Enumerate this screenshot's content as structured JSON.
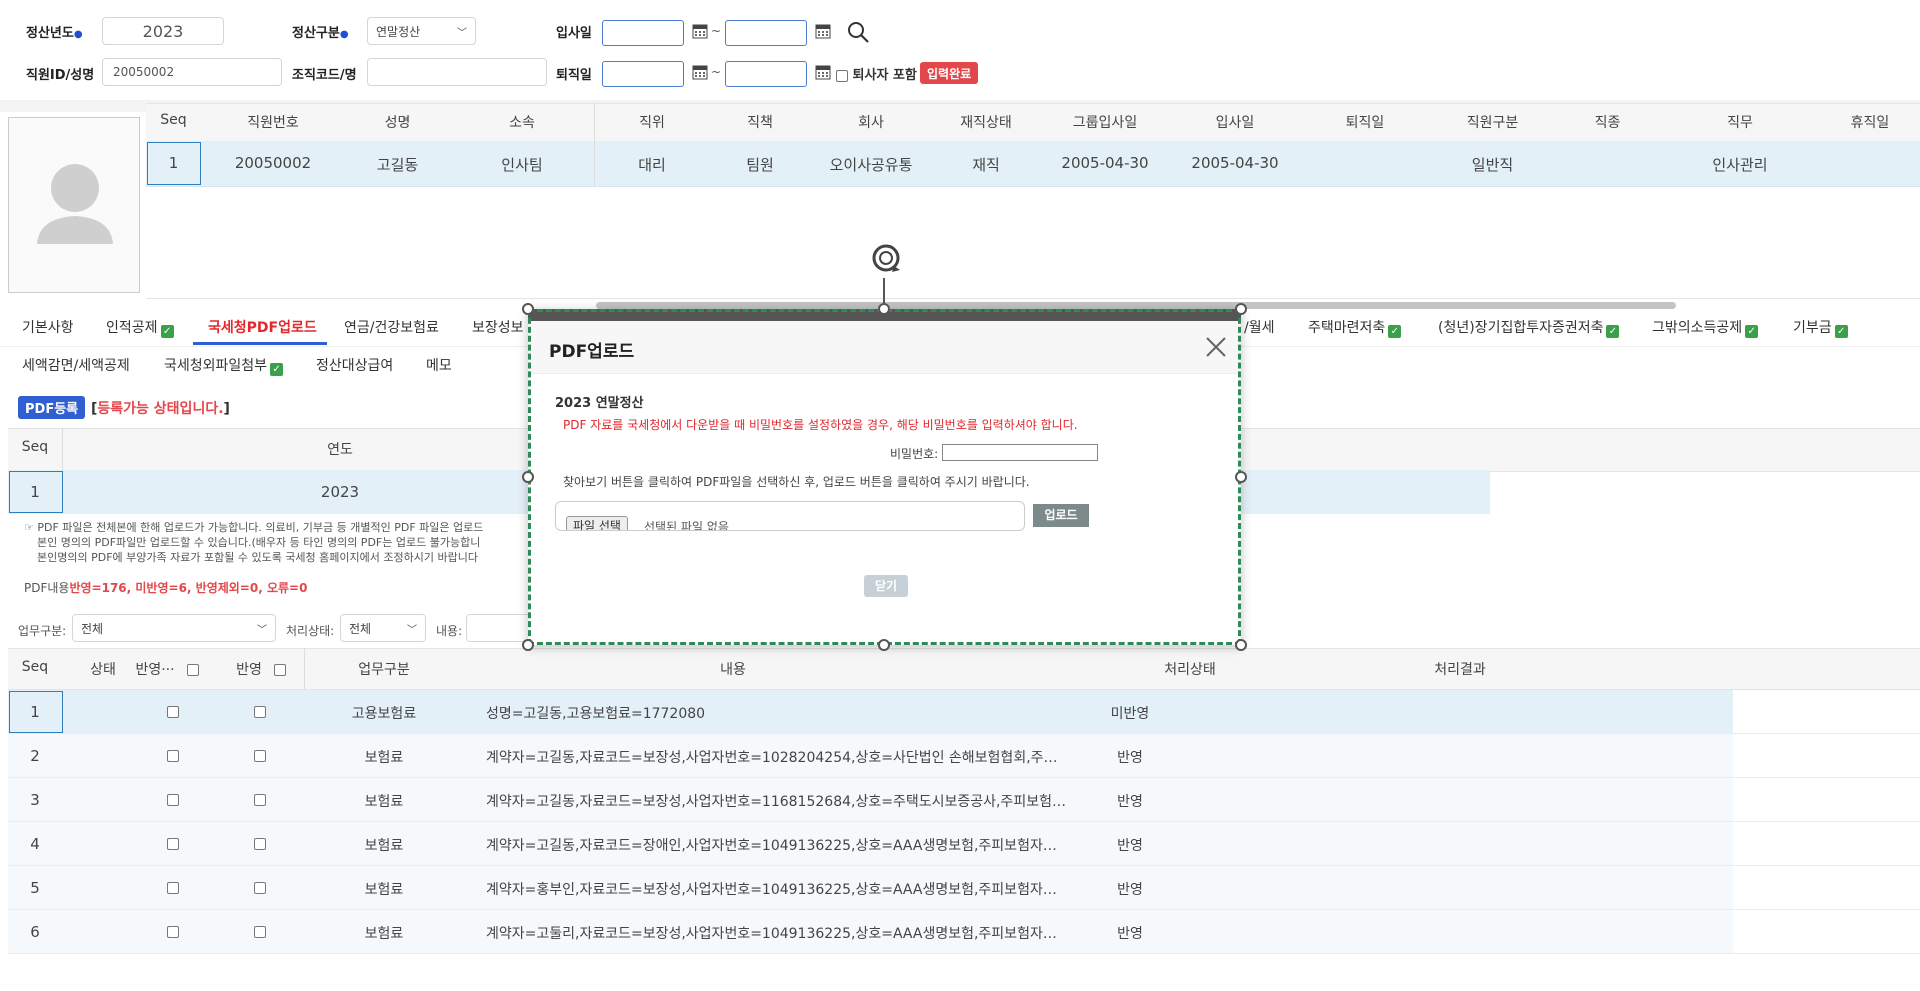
{
  "filters": {
    "year_label": "정산년도",
    "year_value": "2023",
    "type_label": "정산구분",
    "type_value": "연말정산",
    "hire_label": "입사일",
    "tilde": "~",
    "emp_label": "직원ID/성명",
    "emp_value": "20050002",
    "org_label": "조직코드/명",
    "retire_label": "퇴직일",
    "include_retired_label": "퇴사자 포함",
    "input_done_badge": "입력완료"
  },
  "employee_grid": {
    "headers": [
      "Seq",
      "직원번호",
      "성명",
      "소속",
      "직위",
      "직책",
      "회사",
      "재직상태",
      "그룹입사일",
      "입사일",
      "퇴직일",
      "직원구분",
      "직종",
      "직무",
      "휴직일"
    ],
    "row": [
      "1",
      "20050002",
      "고길동",
      "인사팀",
      "대리",
      "팀원",
      "오이사공유통",
      "재직",
      "2005-04-30",
      "2005-04-30",
      "",
      "일반직",
      "",
      "인사관리",
      ""
    ]
  },
  "tabs_row1": [
    {
      "label": "기본사항",
      "check": false
    },
    {
      "label": "인적공제",
      "check": true
    },
    {
      "label": "국세청PDF업로드",
      "check": false,
      "active": true
    },
    {
      "label": "연금/건강보험료",
      "check": false
    },
    {
      "label": "보장성보",
      "check": false
    },
    {
      "label": "/월세",
      "check": false
    },
    {
      "label": "주택마련저축",
      "check": true
    },
    {
      "label": "(청년)장기집합투자증권저축",
      "check": true
    },
    {
      "label": "그밖의소득공제",
      "check": true
    },
    {
      "label": "기부금",
      "check": true
    }
  ],
  "tabs_row2": [
    {
      "label": "세액감면/세액공제",
      "check": false
    },
    {
      "label": "국세청외파일첨부",
      "check": true
    },
    {
      "label": "정산대상급여",
      "check": false
    },
    {
      "label": "메모",
      "check": false
    }
  ],
  "pdf_section": {
    "register_button": "PDF등록",
    "status_open": "[",
    "status_text": "등록가능 상태입니다.",
    "status_close": "]",
    "grid_headers": [
      "Seq",
      "연도"
    ],
    "grid_row": [
      "1",
      "2023"
    ],
    "note_line1": "☞ PDF 파일은 전체본에 한해 업로드가 가능합니다. 의료비, 기부금 등 개별적인 PDF 파일은 업로드",
    "note_line2": "본인 명의의 PDF파일만 업로드할 수 있습니다.(배우자 등 타인 명의의 PDF는 업로드 불가능합니",
    "note_line3": "본인명의의 PDF에 부양가족 자료가 포함될 수 있도록 국세청 홈페이지에서 조정하시기 바랍니다",
    "content_label": "PDF내용",
    "content_summary": "반영=176, 미반영=6, 반영제외=0, 오류=0"
  },
  "detail_filters": {
    "biz_label": "업무구분:",
    "biz_value": "전체",
    "status_label": "처리상태:",
    "status_value": "전체",
    "content_label": "내용:"
  },
  "detail_grid": {
    "headers": [
      "Seq",
      "상태",
      "반영···",
      "반영",
      "업무구분",
      "내용",
      "처리상태",
      "처리결과"
    ],
    "rows": [
      {
        "seq": "1",
        "biz": "고용보험료",
        "content": "성명=고길동,고용보험료=1772080",
        "status": "미반영"
      },
      {
        "seq": "2",
        "biz": "보험료",
        "content": "계약자=고길동,자료코드=보장성,사업자번호=1028204254,상호=사단법인 손해보험협회,주피보…",
        "status": "반영"
      },
      {
        "seq": "3",
        "biz": "보험료",
        "content": "계약자=고길동,자료코드=보장성,사업자번호=1168152684,상호=주택도시보증공사,주피보험자=…",
        "status": "반영"
      },
      {
        "seq": "4",
        "biz": "보험료",
        "content": "계약자=고길동,자료코드=장애인,사업자번호=1049136225,상호=AAA생명보험,주피보험자=고영…",
        "status": "반영"
      },
      {
        "seq": "5",
        "biz": "보험료",
        "content": "계약자=홍부인,자료코드=보장성,사업자번호=1049136225,상호=AAA생명보험,주피보험자=홍부…",
        "status": "반영"
      },
      {
        "seq": "6",
        "biz": "보험료",
        "content": "계약자=고둘리,자료코드=보장성,사업자번호=1049136225,상호=AAA생명보험,주피보험자=고둘…",
        "status": "반영"
      }
    ]
  },
  "modal": {
    "title": "PDF업로드",
    "section_title": "2023 연말정산",
    "warning": "PDF 자료를 국세청에서 다운받을 때 비밀번호를 설정하였을 경우, 해당 비밀번호를 입력하셔야 합니다.",
    "password_label": "비밀번호:",
    "instruction": "찾아보기 버튼을 클릭하여 PDF파일을 선택하신 후, 업로드 버튼을 클릭하여 주시기 바랍니다.",
    "file_button": "파일 선택",
    "file_status": "선택된 파일 없음",
    "upload_button": "업로드",
    "close_button": "닫기"
  },
  "colors": {
    "accent_blue": "#2f5fd0",
    "red": "#e2474b",
    "selected_row": "#e4f0f8",
    "selection_dash": "#2e8b57"
  }
}
